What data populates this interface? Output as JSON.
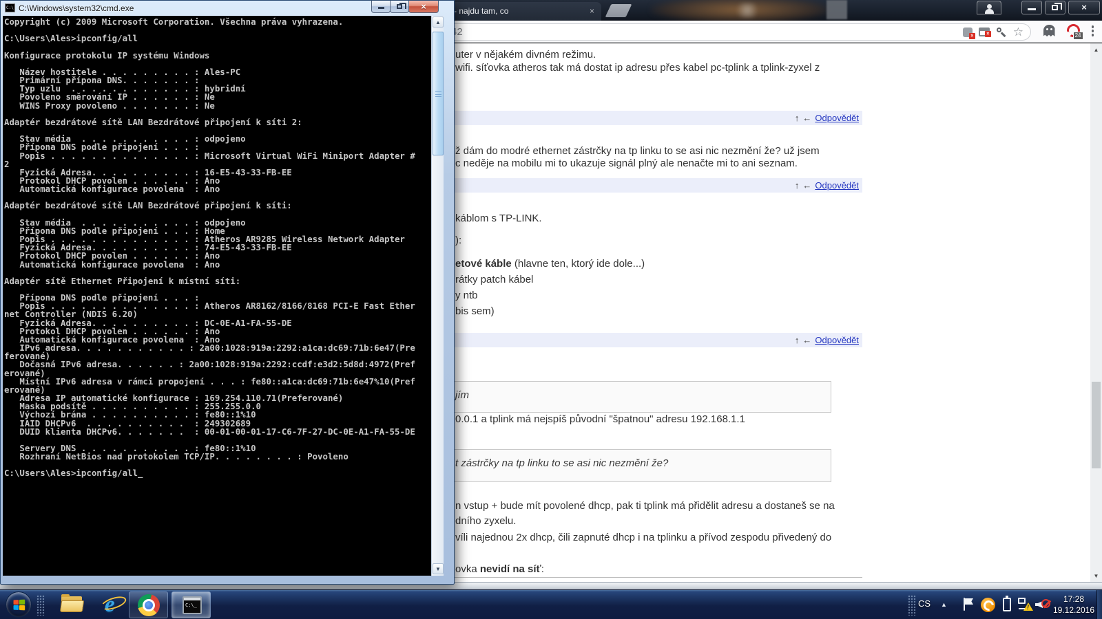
{
  "cmd": {
    "title": "C:\\Windows\\system32\\cmd.exe",
    "icon_label": "C:\\",
    "console_lines": [
      "Copyright (c) 2009 Microsoft Corporation. Všechna práva vyhrazena.",
      "",
      "C:\\Users\\Ales>ipconfig/all",
      "",
      "Konfigurace protokolu IP systému Windows",
      "",
      "   Název hostitele . . . . . . . . . : Ales-PC",
      "   Primární přípona DNS. . . . . . . :",
      "   Typ uzlu  . . . . . . . . . . . . : hybridní",
      "   Povoleno směrování IP . . . . . . : Ne",
      "   WINS Proxy povoleno . . . . . . . : Ne",
      "",
      "Adaptér bezdrátové sítě LAN Bezdrátové připojení k síti 2:",
      "",
      "   Stav média  . . . . . . . . . . . : odpojeno",
      "   Přípona DNS podle připojení . . . :",
      "   Popis . . . . . . . . . . . . . . : Microsoft Virtual WiFi Miniport Adapter #",
      "2",
      "   Fyzická Adresa. . . . . . . . . . : 16-E5-43-33-FB-EE",
      "   Protokol DHCP povolen . . . . . . : Ano",
      "   Automatická konfigurace povolena  : Ano",
      "",
      "Adaptér bezdrátové sítě LAN Bezdrátové připojení k síti:",
      "",
      "   Stav média  . . . . . . . . . . . : odpojeno",
      "   Přípona DNS podle připojení . . . : Home",
      "   Popis . . . . . . . . . . . . . . : Atheros AR9285 Wireless Network Adapter",
      "   Fyzická Adresa. . . . . . . . . . : 74-E5-43-33-FB-EE",
      "   Protokol DHCP povolen . . . . . . : Ano",
      "   Automatická konfigurace povolena  : Ano",
      "",
      "Adaptér sítě Ethernet Připojení k místní síti:",
      "",
      "   Přípona DNS podle připojení . . . :",
      "   Popis . . . . . . . . . . . . . . : Atheros AR8162/8166/8168 PCI-E Fast Ether",
      "net Controller (NDIS 6.20)",
      "   Fyzická Adresa. . . . . . . . . . : DC-0E-A1-FA-55-DE",
      "   Protokol DHCP povolen . . . . . . : Ano",
      "   Automatická konfigurace povolena  : Ano",
      "   IPv6 adresa. . . . . . . . . . . : 2a00:1028:919a:2292:a1ca:dc69:71b:6e47(Pre",
      "ferované)",
      "   Dočasná IPv6 adresa. . . . . . : 2a00:1028:919a:2292:ccdf:e3d2:5d8d:4972(Pref",
      "erované)",
      "   Místní IPv6 adresa v rámci propojení . . . : fe80::a1ca:dc69:71b:6e47%10(Pref",
      "erované)",
      "   Adresa IP automatické konfigurace : 169.254.110.71(Preferované)",
      "   Maska podsítě . . . . . . . . . . : 255.255.0.0",
      "   Výchozí brána . . . . . . . . . . : fe80::1%10",
      "   IAID DHCPv6  . . . . . . . . . .  : 249302689",
      "   DUID klienta DHCPv6. . . . . . .  : 00-01-00-01-17-C6-7F-27-DC-0E-A1-FA-55-DE",
      "",
      "   Servery DNS . . . . . . . . . . . : fe80::1%10",
      "   Rozhraní NetBios nad protokolem TCP/IP. . . . . . . . : Povoleno",
      "",
      "C:\\Users\\Ales>ipconfig/all_"
    ]
  },
  "browser": {
    "tab_title": "- najdu tam, co",
    "tab_close": "×",
    "url_text": "42",
    "extension_badge_x": "×",
    "redring_badge_count": "24",
    "scroll_up": "▲",
    "scroll_down": "▼"
  },
  "forum": {
    "reply_label": "Odpovědět",
    "arrow_up": "↑",
    "arrow_back": "←",
    "t1": "uter v nějakém divném režimu.",
    "t2": "wifi. síťovka atheros tak má dostat ip adresu přes kabel pc-tplink a tplink-zyxel z",
    "t3": "ž dám do modré ethernet zástrčky na tp linku to se asi nic nezmění že? už jsem",
    "t4": "c neděje na mobilu mi to ukazuje signál plný ale nenačte mi to ani seznam.",
    "t5": "káblom s TP-LINK.",
    "t6": "):",
    "t7_bold": "etové káble",
    "t7_rest": " (hlavne ten, ktorý ide dole...)",
    "t8": "rátky patch kábel",
    "t9": "y ntb",
    "t10": "bis sem)",
    "q1": "jím",
    "t11": "0.0.1 a tplink má nejspíš původní \"špatnou\" adresu 192.168.1.1",
    "q2": "t zástrčky na tp linku to se asi nic nezmění že?",
    "t12": "n vstup + bude mít povolené dhcp, pak ti tplink má přidělit adresu a dostaneš se na",
    "t13": "dního zyxelu.",
    "t14": "víli najednou 2x dhcp, čili zapnuté dhcp i na tplinku a přívod zespodu přivedený do",
    "t15_pre": "ovka ",
    "t15_bold": "nevidí na síť",
    "t15_post": ":"
  },
  "taskbar": {
    "language": "CS",
    "tray_chevron": "▲",
    "time": "17:28",
    "date": "19.12.2016",
    "cmd_icon_text": "C:\\_"
  },
  "cmd_scroll": {
    "up": "▲",
    "down": "▼"
  }
}
